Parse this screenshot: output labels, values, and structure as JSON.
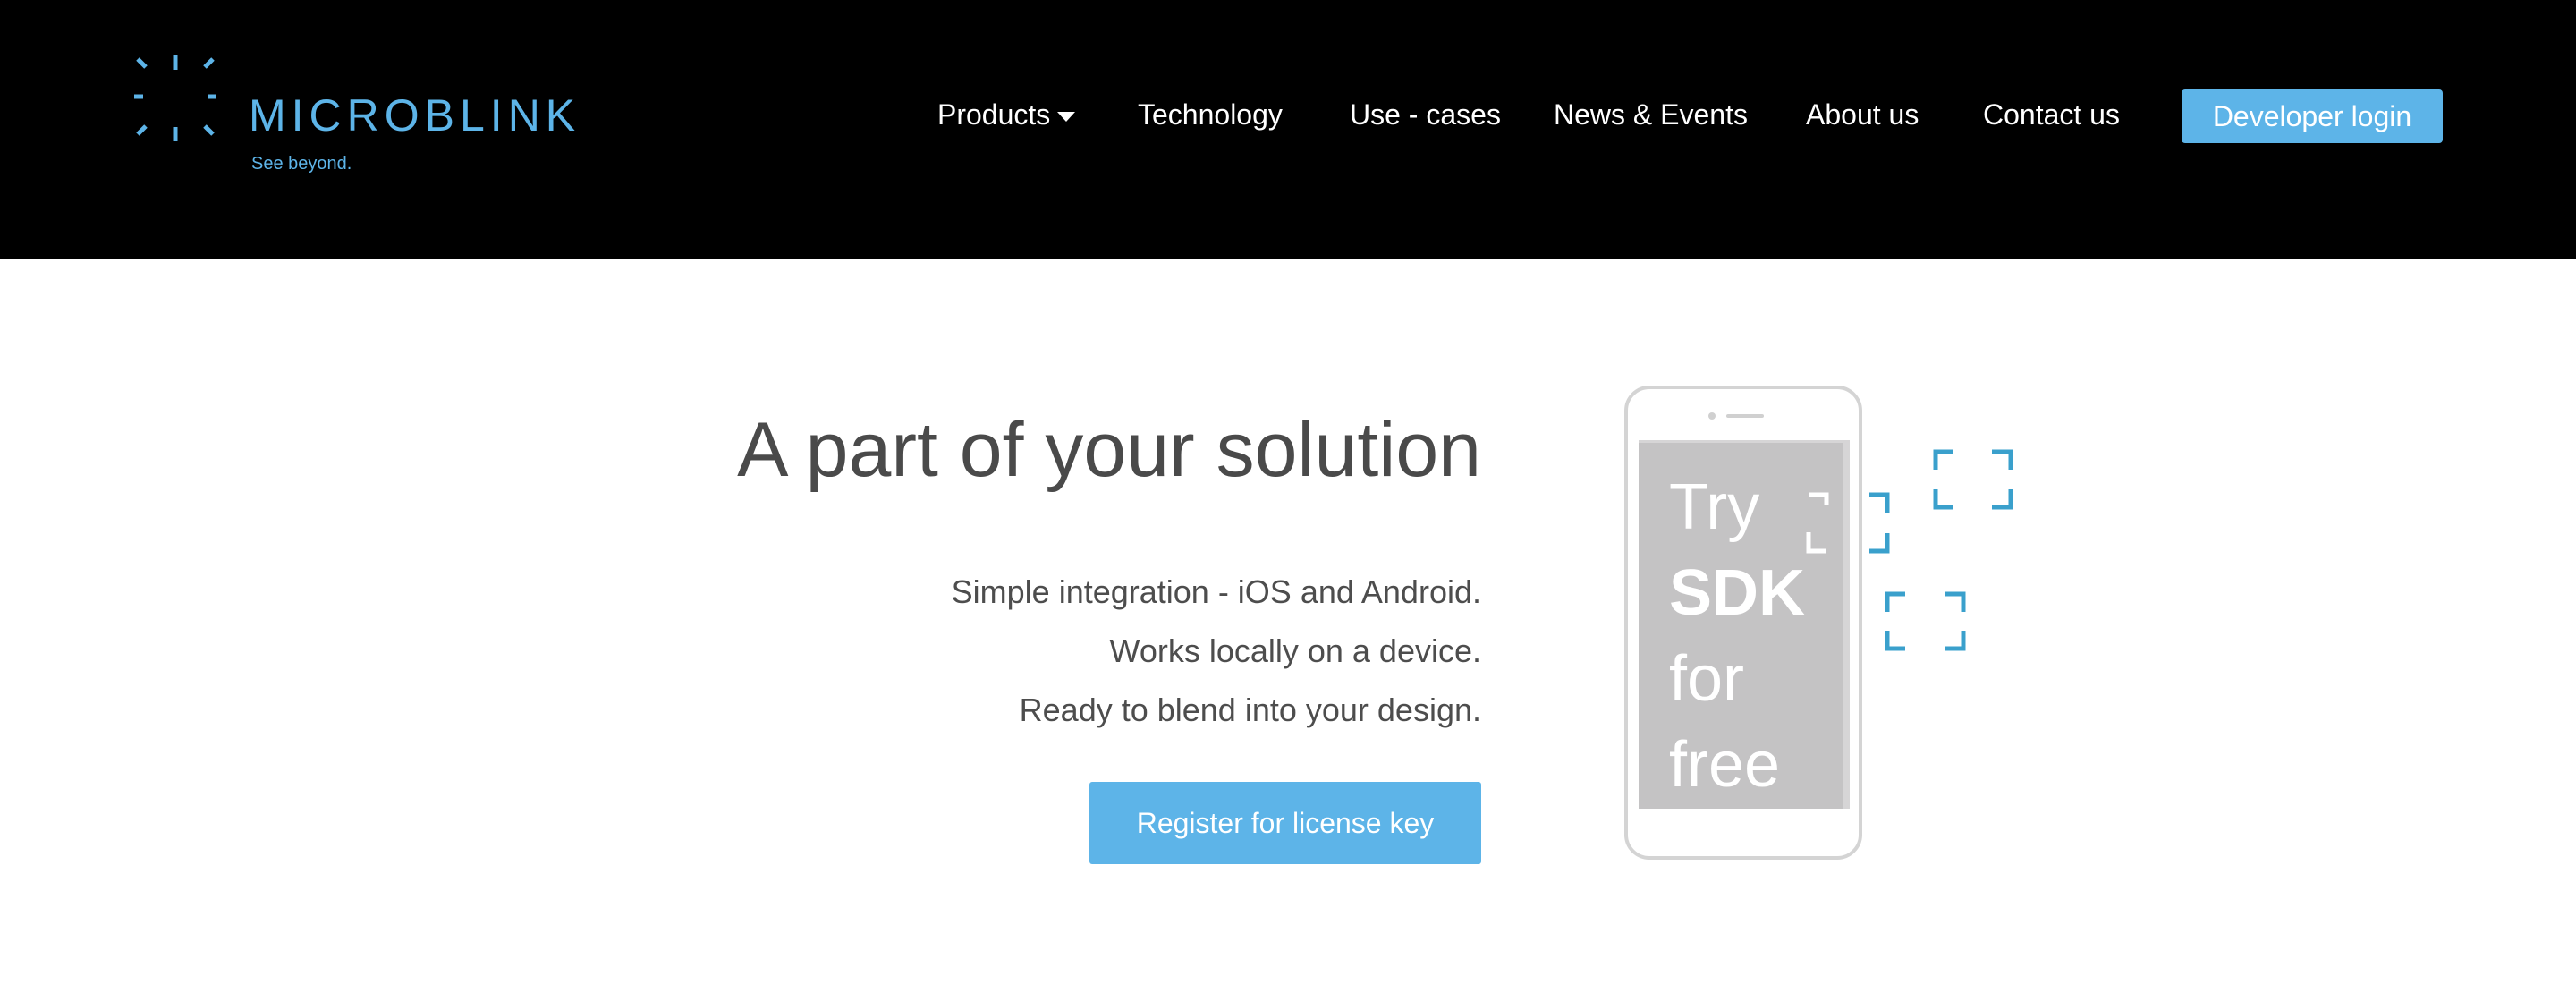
{
  "header": {
    "logo": {
      "wordmark": "MICROBLINK",
      "tagline": "See beyond.",
      "icon": "microblink-spark-icon"
    },
    "nav": [
      {
        "label": "Products",
        "has_dropdown": true,
        "icon": "caret-down-icon"
      },
      {
        "label": "Technology"
      },
      {
        "label": "Use - cases"
      },
      {
        "label": "News & Events"
      },
      {
        "label": "About us"
      },
      {
        "label": "Contact us"
      }
    ],
    "developer_login": "Developer login"
  },
  "hero": {
    "title": "A part of your solution",
    "lines": [
      "Simple integration - iOS and Android.",
      "Works locally on a device.",
      "Ready to blend into your design."
    ],
    "cta": "Register for license key"
  },
  "phone": {
    "lines": [
      "Try",
      "SDK",
      "for",
      "free"
    ],
    "decor_icon": "scan-frame-icon"
  },
  "colors": {
    "brand_blue": "#5db4e8",
    "scan_frame_blue": "#3aa0cc",
    "header_bg": "#000000",
    "text_dark": "#4a4a4a",
    "phone_screen": "#c4c3c4"
  }
}
